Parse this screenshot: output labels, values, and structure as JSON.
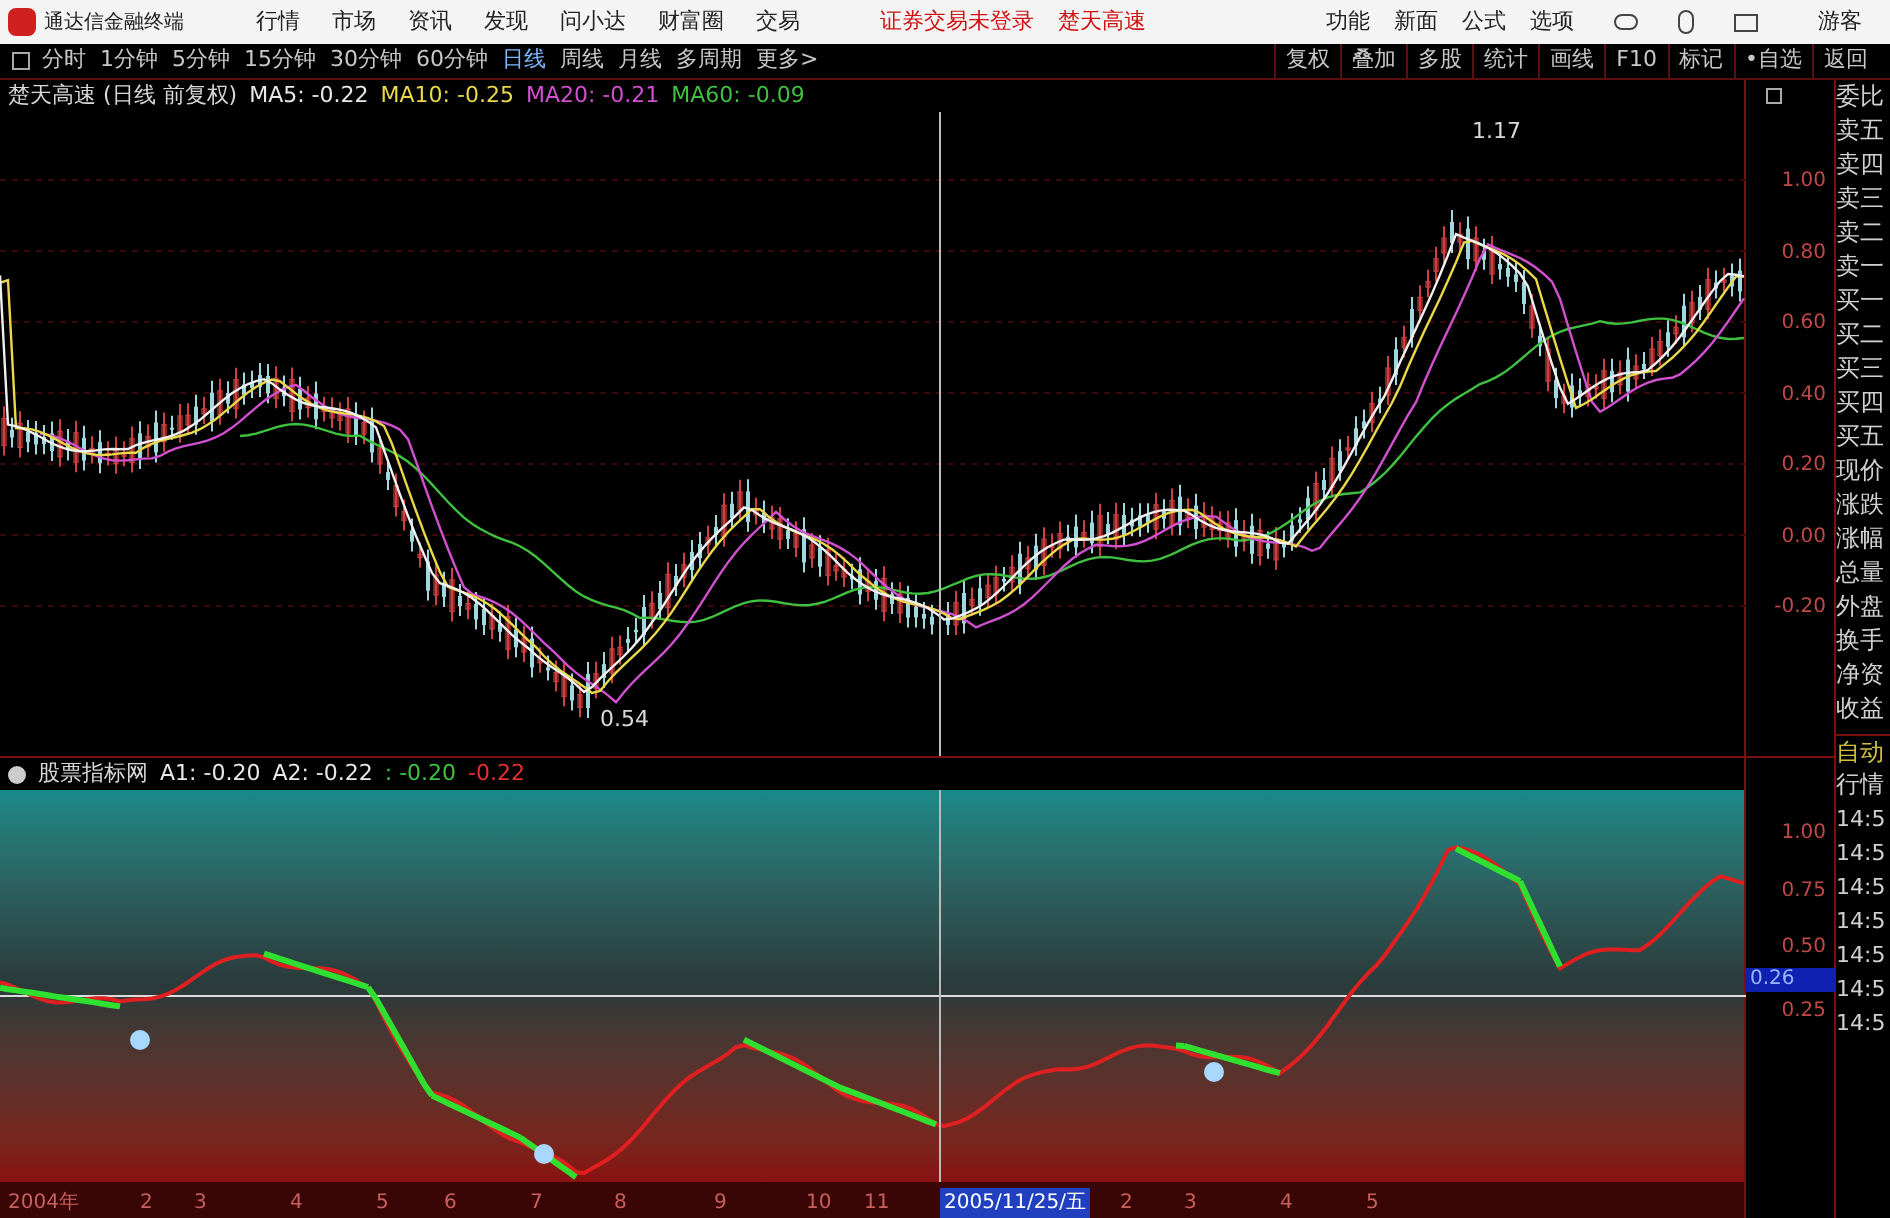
{
  "app": {
    "title": "通达信金融终端"
  },
  "menu": [
    {
      "label": "行情"
    },
    {
      "label": "市场"
    },
    {
      "label": "资讯"
    },
    {
      "label": "发现"
    },
    {
      "label": "问小达"
    },
    {
      "label": "财富圈"
    },
    {
      "label": "交易"
    }
  ],
  "notices": [
    {
      "label": "证券交易未登录"
    },
    {
      "label": "楚天高速"
    }
  ],
  "right_menu": [
    {
      "label": "功能"
    },
    {
      "label": "新面"
    },
    {
      "label": "公式"
    },
    {
      "label": "选项"
    }
  ],
  "user": {
    "label": "游客"
  },
  "periods": [
    {
      "label": "分时",
      "selected": false
    },
    {
      "label": "1分钟",
      "selected": false
    },
    {
      "label": "5分钟",
      "selected": false
    },
    {
      "label": "15分钟",
      "selected": false
    },
    {
      "label": "30分钟",
      "selected": false
    },
    {
      "label": "60分钟",
      "selected": false
    },
    {
      "label": "日线",
      "selected": true
    },
    {
      "label": "周线",
      "selected": false
    },
    {
      "label": "月线",
      "selected": false
    },
    {
      "label": "多周期",
      "selected": false
    },
    {
      "label": "更多>",
      "selected": false
    }
  ],
  "tools": [
    {
      "label": "复权"
    },
    {
      "label": "叠加"
    },
    {
      "label": "多股"
    },
    {
      "label": "统计"
    },
    {
      "label": "画线"
    },
    {
      "label": "F10"
    },
    {
      "label": "标记"
    },
    {
      "label": "•自选"
    },
    {
      "label": "返回"
    }
  ],
  "price_chart": {
    "title": "楚天高速 (日线 前复权)",
    "legend": [
      {
        "label": "MA5: -0.22",
        "color": "#e8e8e8"
      },
      {
        "label": "MA10: -0.25",
        "color": "#e8d84a"
      },
      {
        "label": "MA20: -0.21",
        "color": "#d050d0"
      },
      {
        "label": "MA60: -0.09",
        "color": "#40c040"
      }
    ],
    "high_label": "1.17",
    "low_label": "0.54",
    "yticks": [
      "1.00",
      "0.80",
      "0.60",
      "0.40",
      "0.20",
      "0.00",
      "-0.20"
    ]
  },
  "indicator_chart": {
    "title": "股票指标网",
    "legend": [
      {
        "label": "A1: -0.20",
        "color": "#e8e8e8"
      },
      {
        "label": "A2: -0.22",
        "color": "#e8e8e8"
      },
      {
        "label": ": -0.20",
        "color": "#40c040"
      },
      {
        "label": "-0.22",
        "color": "#e03030"
      }
    ],
    "yticks": [
      "1.00",
      "0.75",
      "0.50",
      "0.25"
    ],
    "cursor_value": "0.26"
  },
  "time_axis": [
    {
      "label": "2004年",
      "selected": false
    },
    {
      "label": "2",
      "selected": false
    },
    {
      "label": "3",
      "selected": false
    },
    {
      "label": "4",
      "selected": false
    },
    {
      "label": "5",
      "selected": false
    },
    {
      "label": "6",
      "selected": false
    },
    {
      "label": "7",
      "selected": false
    },
    {
      "label": "8",
      "selected": false
    },
    {
      "label": "9",
      "selected": false
    },
    {
      "label": "10",
      "selected": false
    },
    {
      "label": "11",
      "selected": false
    },
    {
      "label": "2005/11/25/五",
      "selected": true
    },
    {
      "label": "2",
      "selected": false
    },
    {
      "label": "3",
      "selected": false
    },
    {
      "label": "4",
      "selected": false
    },
    {
      "label": "5",
      "selected": false
    }
  ],
  "quote_panel": [
    {
      "label": "委比"
    },
    {
      "label": "卖五"
    },
    {
      "label": "卖四"
    },
    {
      "label": "卖三"
    },
    {
      "label": "卖二"
    },
    {
      "label": "卖一"
    },
    {
      "label": "买一"
    },
    {
      "label": "买二"
    },
    {
      "label": "买三"
    },
    {
      "label": "买四"
    },
    {
      "label": "买五"
    },
    {
      "label": "现价"
    },
    {
      "label": "涨跌"
    },
    {
      "label": "涨幅"
    },
    {
      "label": "总量"
    },
    {
      "label": "外盘"
    },
    {
      "label": "换手"
    },
    {
      "label": "净资"
    },
    {
      "label": "收益"
    }
  ],
  "tick_panel": {
    "title": "自动",
    "subtitle": "行情",
    "times": [
      "14:5",
      "14:5",
      "14:5",
      "14:5",
      "14:5",
      "14:5",
      "14:5"
    ]
  }
}
